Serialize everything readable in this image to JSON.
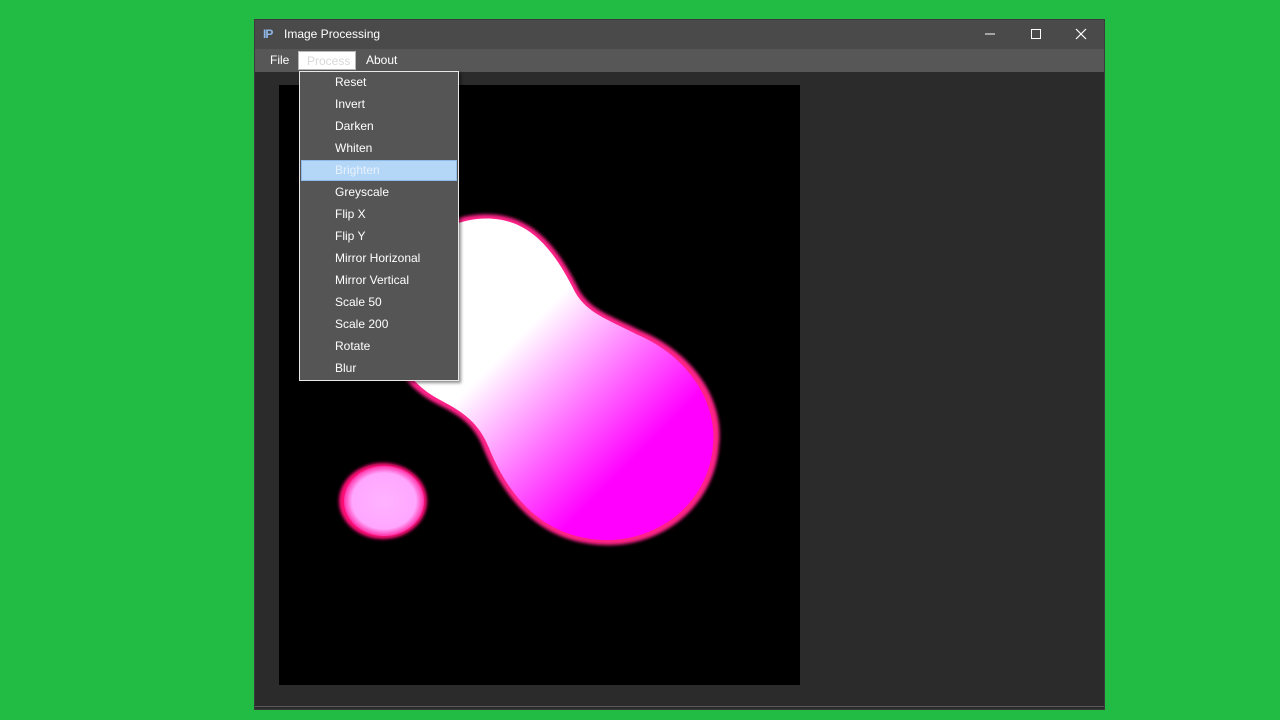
{
  "window": {
    "title": "Image Processing",
    "app_icon": "ip-app-icon"
  },
  "window_controls": {
    "minimize_icon": "minimize-icon",
    "maximize_icon": "maximize-icon",
    "close_icon": "close-icon"
  },
  "menubar": {
    "items": [
      {
        "label": "File"
      },
      {
        "label": "Process"
      },
      {
        "label": "About"
      }
    ]
  },
  "process_menu": {
    "open": true,
    "highlighted": "Brighten",
    "items": [
      {
        "label": "Reset"
      },
      {
        "label": "Invert"
      },
      {
        "label": "Darken"
      },
      {
        "label": "Whiten"
      },
      {
        "label": "Brighten"
      },
      {
        "label": "Greyscale"
      },
      {
        "label": "Flip X"
      },
      {
        "label": "Flip Y"
      },
      {
        "label": "Mirror Horizonal"
      },
      {
        "label": "Mirror Vertical"
      },
      {
        "label": "Scale 50"
      },
      {
        "label": "Scale 200"
      },
      {
        "label": "Rotate"
      },
      {
        "label": "Blur"
      }
    ]
  },
  "colors": {
    "desktop": "#22bb44",
    "canvas": "#000000",
    "blob_magenta": "#ff00ff",
    "blob_white": "#ffffff",
    "small_blob": "#ffaaff",
    "highlight": "#b4d7f8"
  }
}
